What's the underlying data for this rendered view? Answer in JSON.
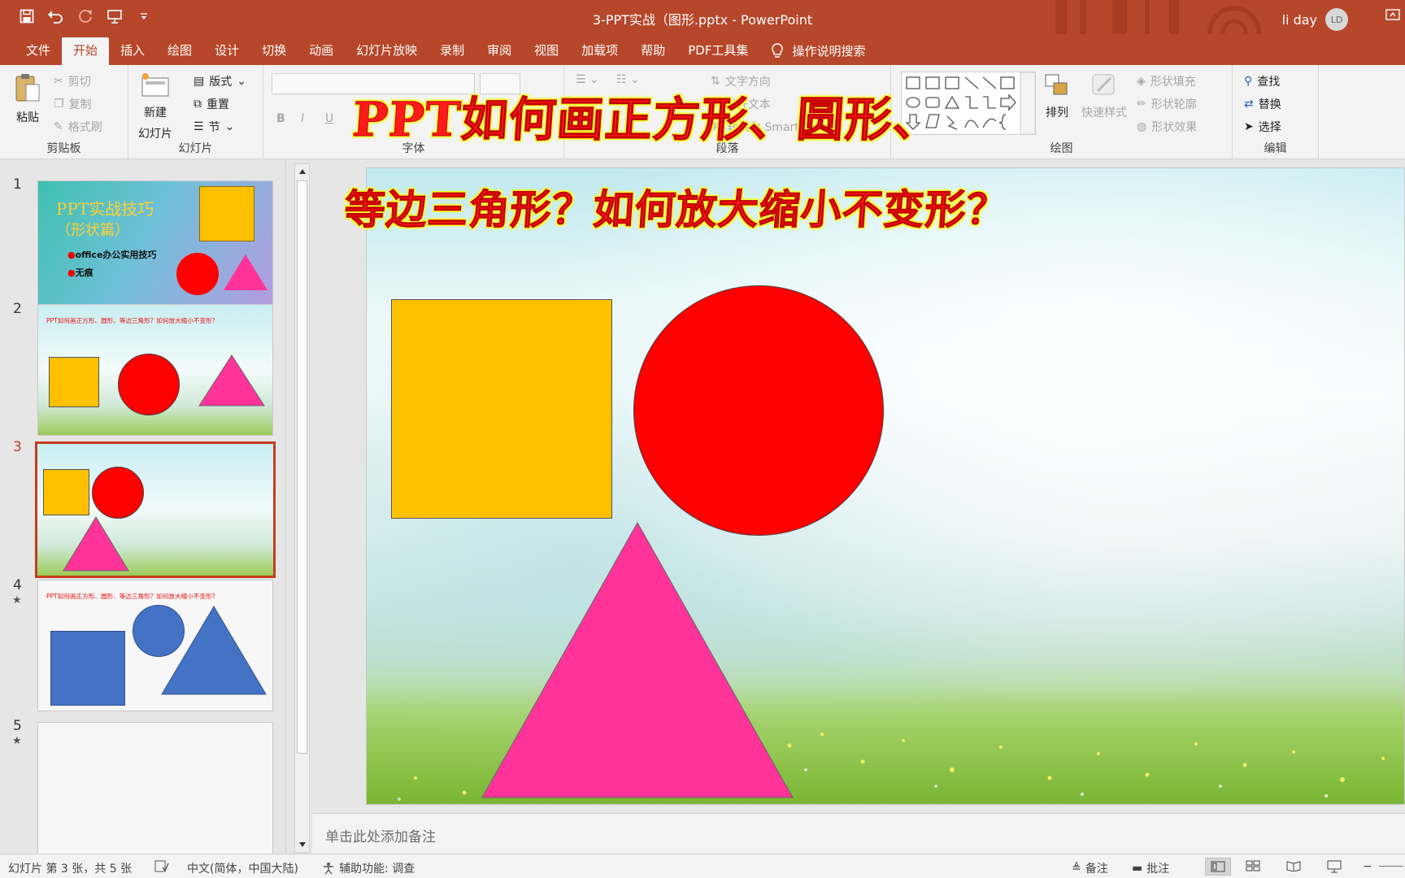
{
  "titlebar": {
    "doc_title": "3-PPT实战（图形.pptx  -  PowerPoint",
    "user_name": "li day",
    "user_initials": "LD"
  },
  "tabs": [
    "文件",
    "开始",
    "插入",
    "绘图",
    "设计",
    "切换",
    "动画",
    "幻灯片放映",
    "录制",
    "审阅",
    "视图",
    "加载项",
    "帮助",
    "PDF工具集"
  ],
  "active_tab": "开始",
  "tell_me": "操作说明搜索",
  "ribbon": {
    "clipboard": {
      "label": "剪贴板",
      "paste": "粘贴",
      "cut": "剪切",
      "copy": "复制",
      "format_painter": "格式刷"
    },
    "slides": {
      "label": "幻灯片",
      "new_slide": "新建",
      "new_slide2": "幻灯片",
      "layout": "版式",
      "reset": "重置",
      "section": "节"
    },
    "font": {
      "label": "字体",
      "bold": "B",
      "italic": "I",
      "underline": "U"
    },
    "paragraph": {
      "label": "段落",
      "text_direction": "文字方向",
      "align_text": "对齐文本",
      "smartart": "转换为 SmartArt"
    },
    "drawing": {
      "label": "绘图",
      "arrange": "排列",
      "quick_styles": "快速样式",
      "fill": "形状填充",
      "outline": "形状轮廓",
      "effects": "形状效果"
    },
    "editing": {
      "label": "编辑",
      "find": "查找",
      "replace": "替换",
      "select": "选择"
    }
  },
  "thumbnails": [
    {
      "num": "1",
      "title_line1": "PPT实战技巧",
      "title_line2": "（形状篇）",
      "bullet1": "office办公实用技巧",
      "bullet2": "无痕"
    },
    {
      "num": "2",
      "title": "PPT如何画正方形、圆形、等边三角形？如何放大缩小不变形？"
    },
    {
      "num": "3"
    },
    {
      "num": "4",
      "star": "★",
      "title": "PPT如何画正方形、圆形、等边三角形？如何放大缩小不变形？"
    },
    {
      "num": "5",
      "star": "★"
    }
  ],
  "overlay": {
    "line1": "PPT如何画正方形、圆形、",
    "line2": "等边三角形？如何放大缩小不变形？"
  },
  "notes_placeholder": "单击此处添加备注",
  "statusbar": {
    "slide_info": "幻灯片 第 3 张，共 5 张",
    "language": "中文(简体，中国大陆)",
    "accessibility": "辅助功能: 调查",
    "notes": "备注",
    "comments": "批注"
  },
  "colors": {
    "accent": "#b7472a",
    "square": "#ffc000",
    "circle": "#ff0000",
    "triangle": "#ff3399",
    "blue_shape": "#4472c4"
  }
}
